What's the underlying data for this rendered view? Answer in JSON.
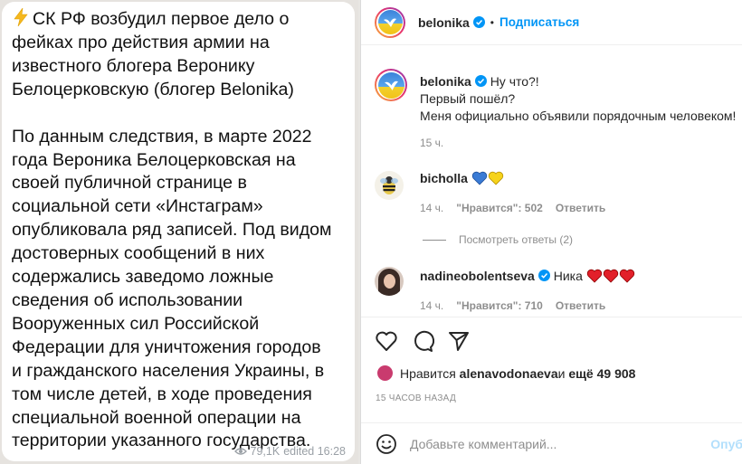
{
  "telegram": {
    "lines_p1": [
      "СК РФ возбудил первое дело о",
      "фейках про действия армии на",
      "известного блогера Веронику",
      "Белоцерковскую (блогер Belonika)"
    ],
    "lines_p2": [
      "По данным следствия, в марте 2022",
      "года Вероника Белоцерковская  на",
      "своей публичной странице в",
      "социальной сети «Инстаграм»",
      "опубликовала ряд записей. Под видом",
      "достоверных сообщений в них",
      "содержались заведомо ложные",
      "сведения об использовании",
      "Вооруженных сил Российской",
      "Федерации для уничтожения городов",
      "и гражданского населения Украины, в",
      "том числе детей, в ходе проведения",
      "специальной военной операции на",
      "территории указанного государства."
    ],
    "views": "79,1K",
    "edited": "edited 16:28"
  },
  "instagram": {
    "header": {
      "username": "belonika",
      "dot": "•",
      "follow": "Подписаться"
    },
    "caption": {
      "username": "belonika",
      "lines": [
        "Ну что?!",
        "Первый пошёл?",
        "Меня официально объявили порядочным человеком!"
      ],
      "time": "15 ч."
    },
    "comments": [
      {
        "username": "bicholla",
        "text": "",
        "time": "14 ч.",
        "likes": "\"Нравится\": 502",
        "reply": "Ответить"
      },
      {
        "username": "nadineobolentseva",
        "text": "Ника",
        "time": "14 ч.",
        "likes": "\"Нравится\": 710",
        "reply": "Ответить"
      }
    ],
    "view_replies": "Посмотреть ответы (2)",
    "liked_by_prefix": "Нравится ",
    "liked_by_user": "alenavodonaeva",
    "liked_by_mid": " и ",
    "liked_by_count": "ещё 49 908",
    "time_ago": "15 ЧАСОВ НАЗАД",
    "add_comment_placeholder": "Добавьте комментарий...",
    "post_label": "Опуб",
    "colors": {
      "link": "#0095f6",
      "verified": "#0095f6",
      "heart": "#ed1c24"
    }
  }
}
